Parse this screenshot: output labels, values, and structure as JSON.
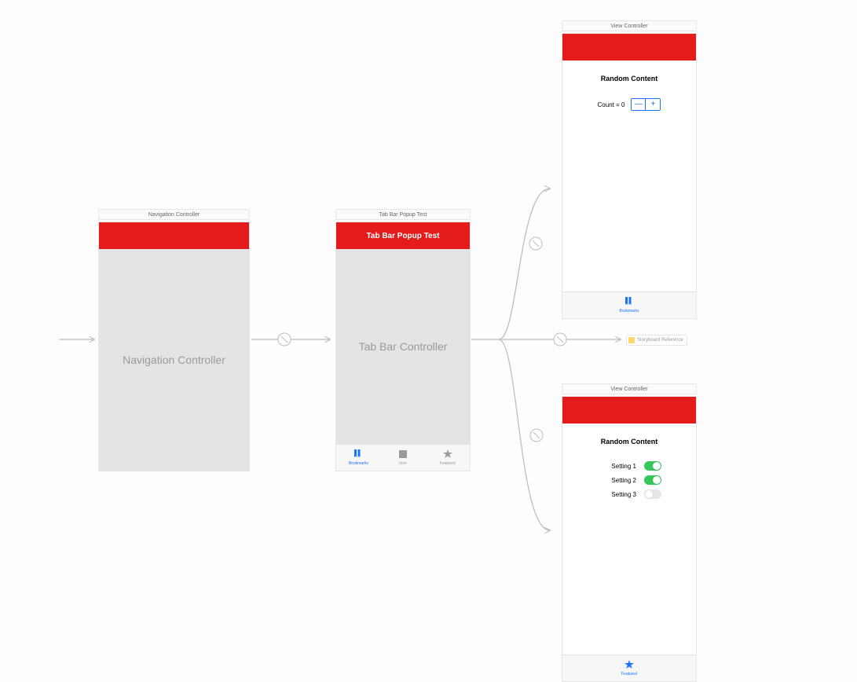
{
  "scenes": {
    "nav": {
      "title": "Navigation Controller",
      "placeholder": "Navigation Controller"
    },
    "tabbar": {
      "title": "Tab Bar Popup Test",
      "nav_title": "Tab Bar Popup Test",
      "placeholder": "Tab Bar Controller",
      "tabs": [
        {
          "label": "Bookmarks",
          "icon": "bookmarks",
          "active": true
        },
        {
          "label": "Item",
          "icon": "square",
          "active": false
        },
        {
          "label": "Featured",
          "icon": "star",
          "active": false
        }
      ]
    },
    "top_vc": {
      "title": "View Controller",
      "heading": "Random Content",
      "count_label": "Count = 0",
      "stepper_minus": "—",
      "stepper_plus": "+",
      "tab": {
        "label": "Bookmarks",
        "icon": "bookmarks",
        "active": true
      }
    },
    "bottom_vc": {
      "title": "View Controller",
      "heading": "Random Content",
      "settings": [
        {
          "label": "Setting 1",
          "on": true
        },
        {
          "label": "Setting 2",
          "on": true
        },
        {
          "label": "Setting 3",
          "on": false
        }
      ],
      "tab": {
        "label": "Featured",
        "icon": "star",
        "active": true
      }
    },
    "sbref": {
      "label": "Storyboard Reference"
    }
  },
  "colors": {
    "red": "#e31b1b",
    "blue": "#1a73ff",
    "green": "#34c759"
  }
}
